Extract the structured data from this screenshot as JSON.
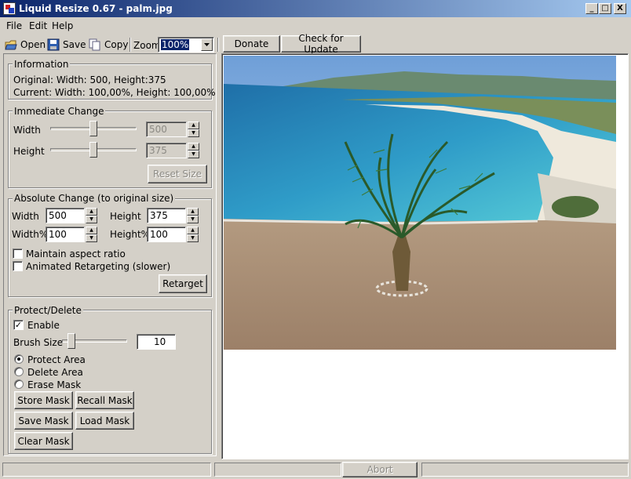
{
  "window": {
    "title": "Liquid Resize 0.67 - palm.jpg",
    "minimize": "_",
    "maximize": "□",
    "close": "X"
  },
  "menu": [
    "File",
    "Edit",
    "Help"
  ],
  "toolbar": {
    "open": "Open",
    "save": "Save",
    "copy": "Copy",
    "zoom_label": "Zoom",
    "zoom_value": "100%",
    "donate": "Donate",
    "check_update": "Check for Update"
  },
  "information": {
    "legend": "Information",
    "original": "Original: Width: 500, Height:375",
    "current": "Current: Width: 100,00%, Height: 100,00%"
  },
  "immediate": {
    "legend": "Immediate Change",
    "width_label": "Width",
    "width_value": "500",
    "height_label": "Height",
    "height_value": "375",
    "reset": "Reset Size"
  },
  "absolute": {
    "legend": "Absolute Change (to original size)",
    "width_label": "Width",
    "width_value": "500",
    "height_label": "Height",
    "height_value": "375",
    "widthpct_label": "Width%",
    "widthpct_value": "100",
    "heightpct_label": "Height%",
    "heightpct_value": "100",
    "aspect": "Maintain aspect ratio",
    "animated": "Animated Retargeting (slower)",
    "retarget": "Retarget"
  },
  "protect": {
    "legend": "Protect/Delete",
    "enable": "Enable",
    "brush_label": "Brush Size",
    "brush_value": "10",
    "protect_area": "Protect Area",
    "delete_area": "Delete Area",
    "erase_mask": "Erase Mask",
    "store_mask": "Store Mask",
    "recall_mask": "Recall Mask",
    "save_mask": "Save Mask",
    "load_mask": "Load Mask",
    "clear_mask": "Clear Mask"
  },
  "status": {
    "abort": "Abort"
  }
}
